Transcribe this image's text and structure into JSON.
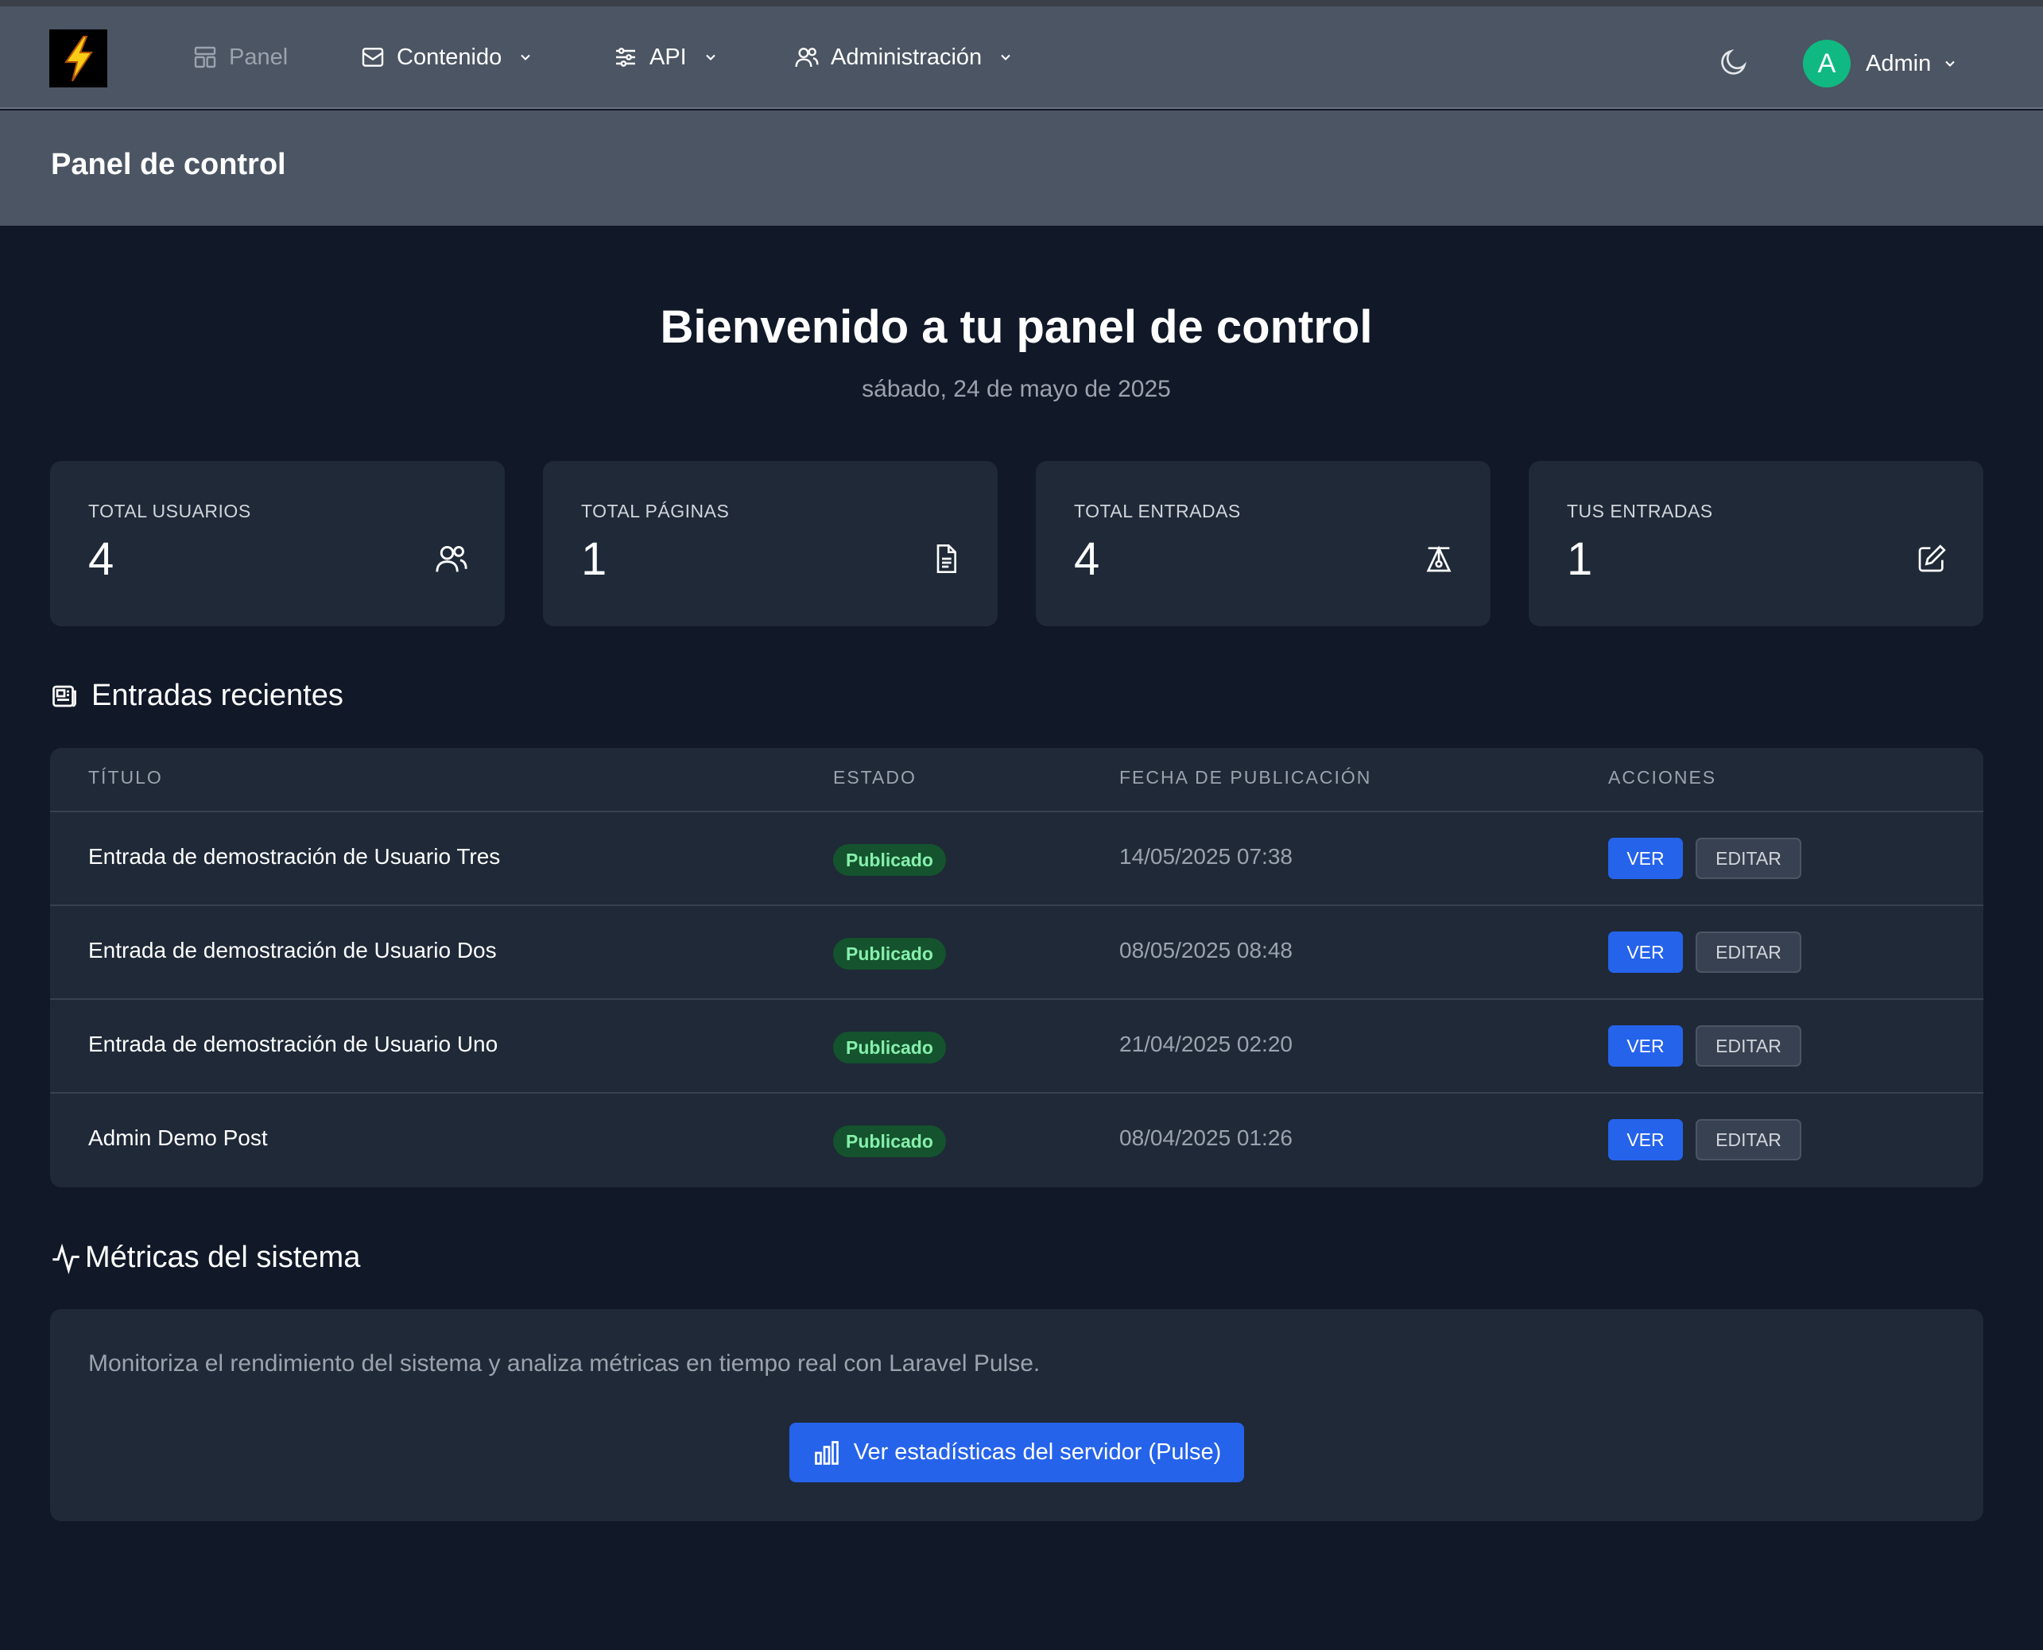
{
  "nav": {
    "items": [
      {
        "label": "Panel"
      },
      {
        "label": "Contenido"
      },
      {
        "label": "API"
      },
      {
        "label": "Administración"
      }
    ],
    "user": {
      "initial": "A",
      "name": "Admin"
    }
  },
  "header": {
    "title": "Panel de control"
  },
  "welcome": {
    "heading": "Bienvenido a tu panel de control",
    "date": "sábado, 24 de mayo de 2025"
  },
  "stats": [
    {
      "label": "TOTAL USUARIOS",
      "value": "4",
      "icon": "users-icon"
    },
    {
      "label": "TOTAL PÁGINAS",
      "value": "1",
      "icon": "document-icon"
    },
    {
      "label": "TOTAL ENTRADAS",
      "value": "4",
      "icon": "posts-icon"
    },
    {
      "label": "TUS ENTRADAS",
      "value": "1",
      "icon": "edit-icon"
    }
  ],
  "recent": {
    "title": "Entradas recientes",
    "columns": [
      "TÍTULO",
      "ESTADO",
      "FECHA DE PUBLICACIÓN",
      "ACCIONES"
    ],
    "rows": [
      {
        "title": "Entrada de demostración de Usuario Tres",
        "status": "Publicado",
        "date": "14/05/2025 07:38",
        "view": "VER",
        "edit": "EDITAR"
      },
      {
        "title": "Entrada de demostración de Usuario Dos",
        "status": "Publicado",
        "date": "08/05/2025 08:48",
        "view": "VER",
        "edit": "EDITAR"
      },
      {
        "title": "Entrada de demostración de Usuario Uno",
        "status": "Publicado",
        "date": "21/04/2025 02:20",
        "view": "VER",
        "edit": "EDITAR"
      },
      {
        "title": "Admin Demo Post",
        "status": "Publicado",
        "date": "08/04/2025 01:26",
        "view": "VER",
        "edit": "EDITAR"
      }
    ]
  },
  "metrics": {
    "title": "Métricas del sistema",
    "description": "Monitoriza el rendimiento del sistema y analiza métricas en tiempo real con Laravel Pulse.",
    "button": "Ver estadísticas del servidor (Pulse)"
  },
  "colors": {
    "background": "#111827",
    "navbar": "#4b5563",
    "card": "#1f2937",
    "primary": "#2563eb",
    "success_bg": "#14532d",
    "success_text": "#86efac",
    "avatar": "#10b981"
  }
}
